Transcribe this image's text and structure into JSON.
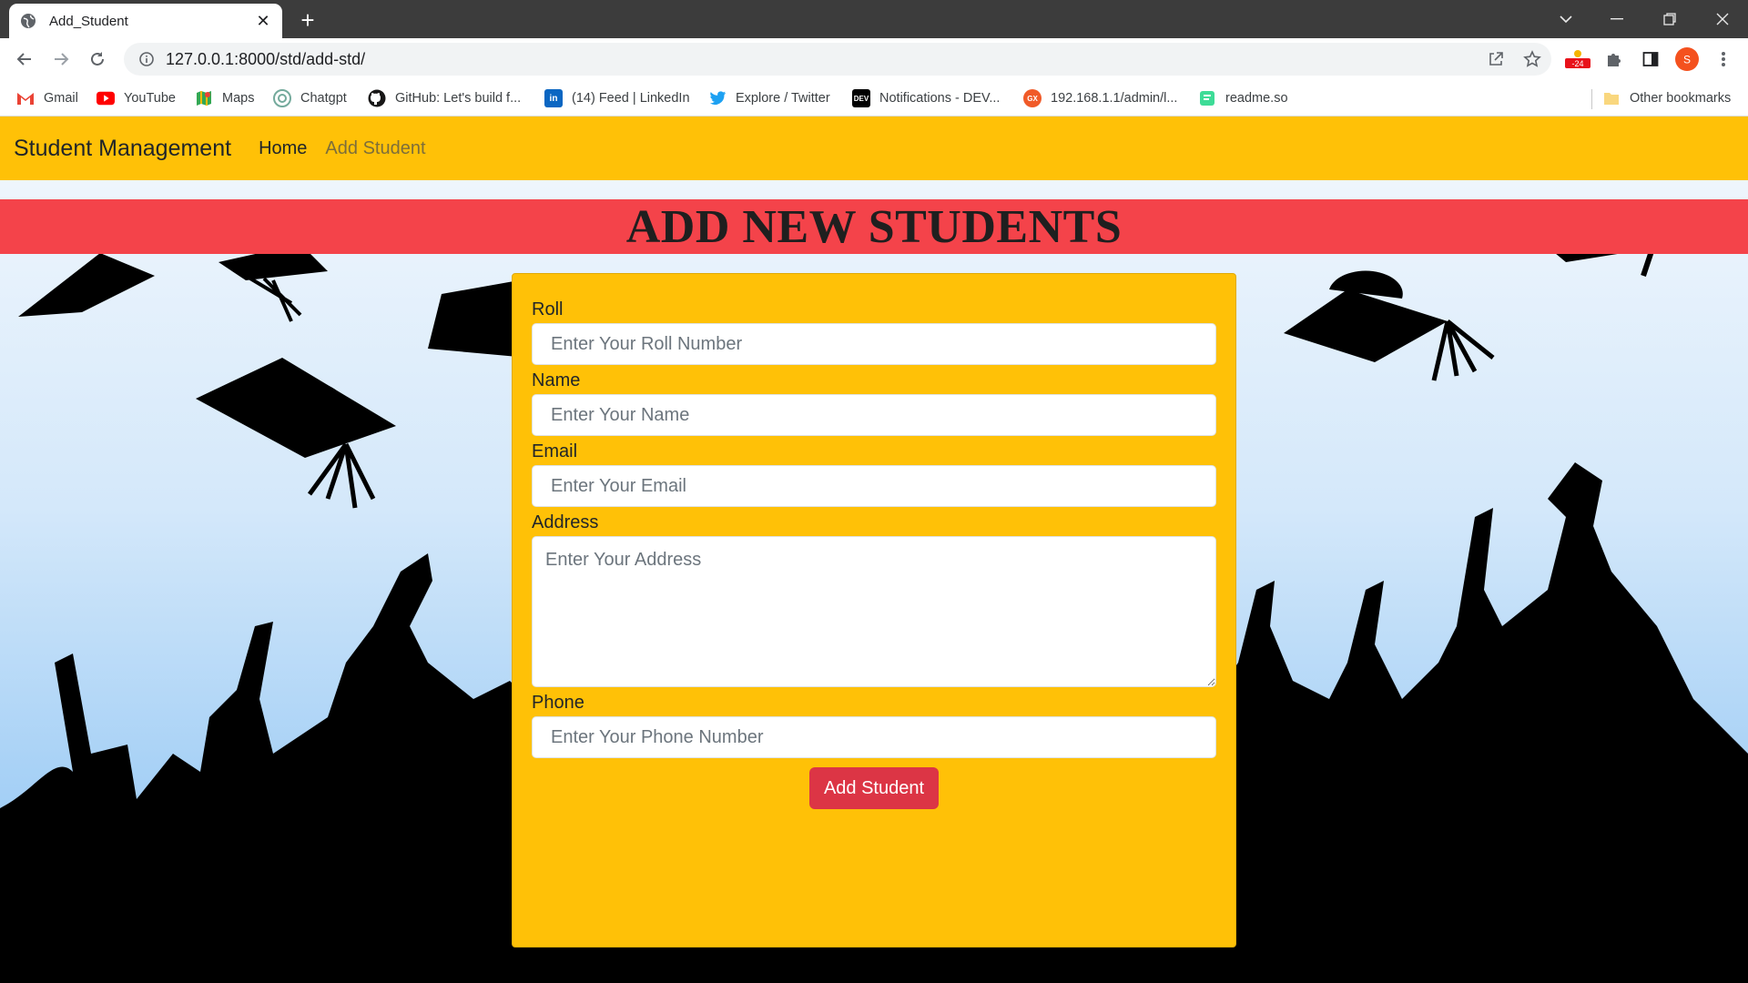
{
  "browser": {
    "tab_title": "Add_Student",
    "url": "127.0.0.1:8000/std/add-std/",
    "extension_badge": "-24",
    "profile_initial": "S",
    "bookmarks": [
      {
        "label": "Gmail",
        "icon": "gmail-icon",
        "color": "#ea4335"
      },
      {
        "label": "YouTube",
        "icon": "youtube-icon",
        "color": "#ff0000"
      },
      {
        "label": "Maps",
        "icon": "maps-icon",
        "color": "#34a853"
      },
      {
        "label": "Chatgpt",
        "icon": "chatgpt-icon",
        "color": "#74aa9c"
      },
      {
        "label": "GitHub: Let's build f...",
        "icon": "github-icon",
        "color": "#181717"
      },
      {
        "label": "(14) Feed | LinkedIn",
        "icon": "linkedin-icon",
        "color": "#0a66c2"
      },
      {
        "label": "Explore / Twitter",
        "icon": "twitter-icon",
        "color": "#1da1f2"
      },
      {
        "label": "Notifications - DEV...",
        "icon": "dev-icon",
        "color": "#000000"
      },
      {
        "label": "192.168.1.1/admin/l...",
        "icon": "router-icon",
        "color": "#f05a28"
      },
      {
        "label": "readme.so",
        "icon": "readme-icon",
        "color": "#3ddc97"
      }
    ],
    "other_bookmarks": "Other bookmarks"
  },
  "navbar": {
    "brand": "Student Management",
    "links": [
      "Home",
      "Add Student"
    ]
  },
  "banner": {
    "title": "ADD NEW STUDENTS"
  },
  "form": {
    "roll": {
      "label": "Roll",
      "placeholder": "Enter Your Roll Number"
    },
    "name": {
      "label": "Name",
      "placeholder": "Enter Your Name"
    },
    "email": {
      "label": "Email",
      "placeholder": "Enter Your Email"
    },
    "address": {
      "label": "Address",
      "placeholder": "Enter Your Address"
    },
    "phone": {
      "label": "Phone",
      "placeholder": "Enter Your Phone Number"
    },
    "submit_label": "Add Student"
  },
  "colors": {
    "navbar": "#ffc107",
    "banner": "#f4434a",
    "button": "#dc3545"
  }
}
